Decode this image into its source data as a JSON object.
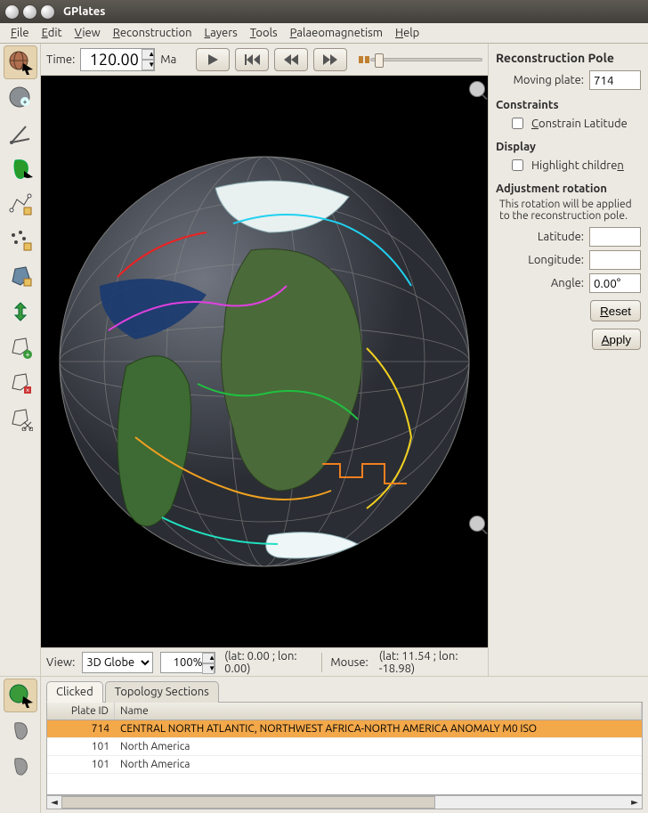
{
  "window": {
    "title": "GPlates"
  },
  "menu": [
    "File",
    "Edit",
    "View",
    "Reconstruction",
    "Layers",
    "Tools",
    "Palaeomagnetism",
    "Help"
  ],
  "time": {
    "label": "Time:",
    "value": "120.00",
    "unit": "Ma",
    "play_icon": "play",
    "rewind_icon": "skip-back",
    "stepback_icon": "step-back",
    "stepfwd_icon": "step-forward"
  },
  "view": {
    "label": "View:",
    "mode": "3D Globe",
    "zoom": "100%",
    "camera_status": "(lat: 0.00 ; lon: 0.00)",
    "mouse_label": "Mouse:",
    "mouse_status": "(lat: 11.54 ; lon: -18.98)"
  },
  "right": {
    "title": "Reconstruction Pole",
    "moving_plate_label": "Moving plate:",
    "moving_plate": "714",
    "constraints_title": "Constraints",
    "constrain_lat": "Constrain Latitude",
    "display_title": "Display",
    "highlight": "Highlight children",
    "adj_title": "Adjustment rotation",
    "adj_desc": "This rotation will be applied to the reconstruction pole.",
    "lat_label": "Latitude:",
    "lat": "",
    "lon_label": "Longitude:",
    "lon": "",
    "angle_label": "Angle:",
    "angle": "0.00°",
    "reset": "Reset",
    "apply": "Apply"
  },
  "tabs": {
    "clicked": "Clicked",
    "topo": "Topology Sections"
  },
  "table": {
    "cols": {
      "id": "Plate ID",
      "name": "Name"
    },
    "rows": [
      {
        "id": "714",
        "name": "CENTRAL NORTH ATLANTIC, NORTHWEST AFRICA-NORTH AMERICA ANOMALY M0 ISO",
        "selected": true
      },
      {
        "id": "101",
        "name": "North America"
      },
      {
        "id": "101",
        "name": "North America"
      }
    ]
  },
  "tools": {
    "cursor": "cursor-globe",
    "hand": "hand-globe",
    "measure": "compass",
    "africa-plus": "africa-add",
    "polyline": "polyline-edit",
    "multipoint": "multipoint-edit",
    "polygon-move": "polygon-move",
    "arrows": "arrows-green",
    "poly-add": "polygon-add",
    "poly-del": "polygon-delete",
    "poly-cut": "polygon-cut"
  },
  "bottom_tools": {
    "select": "globe-select",
    "grey1": "africa-grey",
    "grey2": "africa-grey-2"
  }
}
